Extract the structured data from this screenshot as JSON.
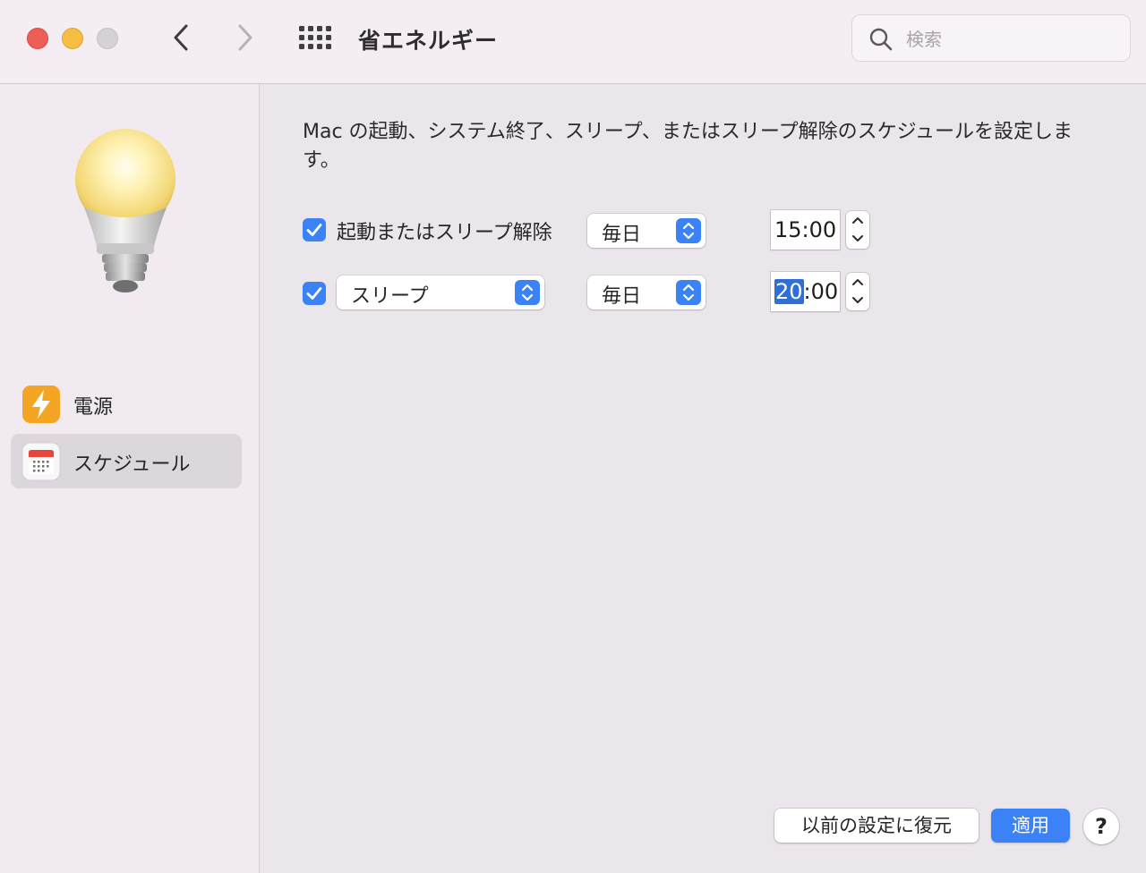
{
  "window": {
    "title": "省エネルギー",
    "search_placeholder": "検索",
    "icons": {
      "back": "chevron-left-icon",
      "forward": "chevron-right-icon",
      "show_all": "grid-icon",
      "search": "magnifier-icon"
    }
  },
  "sidebar": {
    "items": [
      {
        "label": "電源",
        "icon": "lightning-bolt-icon",
        "selected": false
      },
      {
        "label": "スケジュール",
        "icon": "calendar-icon",
        "selected": true
      }
    ]
  },
  "schedule": {
    "description": "Mac の起動、システム終了、スリープ、またはスリープ解除のスケジュールを設定します。",
    "rows": [
      {
        "checked": true,
        "label": "起動またはスリープ解除",
        "frequency": "毎日",
        "time_hour": "15",
        "time_minute": "00",
        "separator": ":"
      },
      {
        "checked": true,
        "action": "スリープ",
        "frequency": "毎日",
        "time_hour": "20",
        "time_minute": "00",
        "separator": ":"
      }
    ]
  },
  "buttons": {
    "restore": "以前の設定に復元",
    "apply": "適用",
    "help": "?"
  },
  "colors": {
    "accent": "#3a82f6",
    "close": "#ee5e57",
    "minimize": "#f5be42",
    "zoom_disabled": "#d5d1d5"
  }
}
